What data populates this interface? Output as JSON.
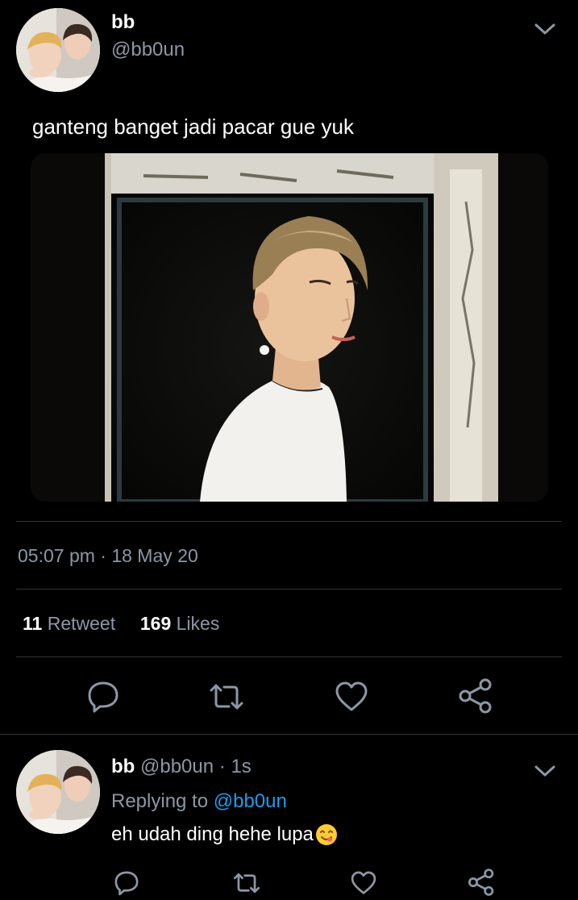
{
  "tweet": {
    "author": {
      "name": "bb",
      "handle": "@bb0un",
      "avatar_icon": "profile-photo-avatar"
    },
    "text": "ganteng banget jadi pacar gue yuk",
    "media_icon": "tweet-photo",
    "timestamp": "05:07 pm · 18 May 20",
    "retweets": {
      "count": "11",
      "label": "Retweet"
    },
    "likes": {
      "count": "169",
      "label": "Likes"
    },
    "actions": [
      "reply-icon",
      "retweet-icon",
      "like-icon",
      "share-icon"
    ],
    "menu_icon": "chevron-down-icon"
  },
  "reply": {
    "name": "bb",
    "handle": "@bb0un",
    "time": " · 1s",
    "replying_label": "Replying to ",
    "replying_to": "@bb0un",
    "text": "eh udah ding hehe lupa",
    "emoji": "yum-face-emoji",
    "actions": [
      "reply-icon",
      "retweet-icon",
      "like-icon",
      "share-icon"
    ],
    "menu_icon": "chevron-down-icon"
  },
  "colors": {
    "background": "#000000",
    "primary_text": "#ffffff",
    "secondary_text": "#8b98a5",
    "accent": "#1d9bf0",
    "divider": "#2f3336",
    "icon": "#8b98a5"
  }
}
